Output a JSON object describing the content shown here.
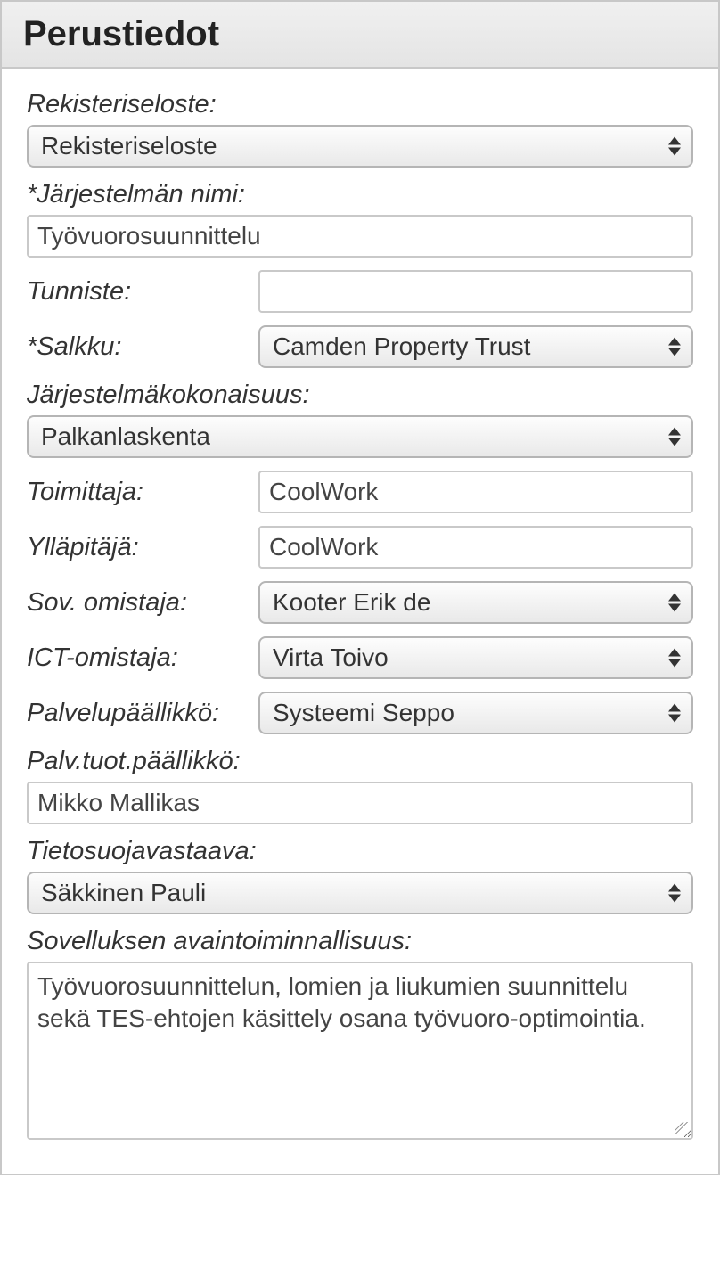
{
  "header": {
    "title": "Perustiedot"
  },
  "fields": {
    "rekisteriseloste": {
      "label": "Rekisteriseloste:",
      "value": "Rekisteriseloste"
    },
    "jarjestelman_nimi": {
      "label": "*Järjestelmän nimi:",
      "value": "Työvuorosuunnittelu"
    },
    "tunniste": {
      "label": "Tunniste:",
      "value": ""
    },
    "salkku": {
      "label": "*Salkku:",
      "value": "Camden Property Trust"
    },
    "jarjestelmakokonaisuus": {
      "label": "Järjestelmäkokonaisuus:",
      "value": "Palkanlaskenta"
    },
    "toimittaja": {
      "label": "Toimittaja:",
      "value": "CoolWork"
    },
    "yllapitaja": {
      "label": "Ylläpitäjä:",
      "value": "CoolWork"
    },
    "sov_omistaja": {
      "label": "Sov. omistaja:",
      "value": "Kooter Erik de"
    },
    "ict_omistaja": {
      "label": "ICT-omistaja:",
      "value": "Virta Toivo"
    },
    "palvelupaallikko": {
      "label": "Palvelupäällikkö:",
      "value": "Systeemi Seppo"
    },
    "palv_tuot_paallikko": {
      "label": "Palv.tuot.päällikkö:",
      "value": "Mikko Mallikas"
    },
    "tietosuojavastaava": {
      "label": "Tietosuojavastaava:",
      "value": "Säkkinen Pauli"
    },
    "sovelluksen_avaintoiminnallisuus": {
      "label": "Sovelluksen avaintoiminnallisuus:",
      "value": "Työvuorosuunnittelun, lomien ja liukumien suunnittelu sekä TES-ehtojen käsittely osana työvuoro-optimointia."
    }
  }
}
